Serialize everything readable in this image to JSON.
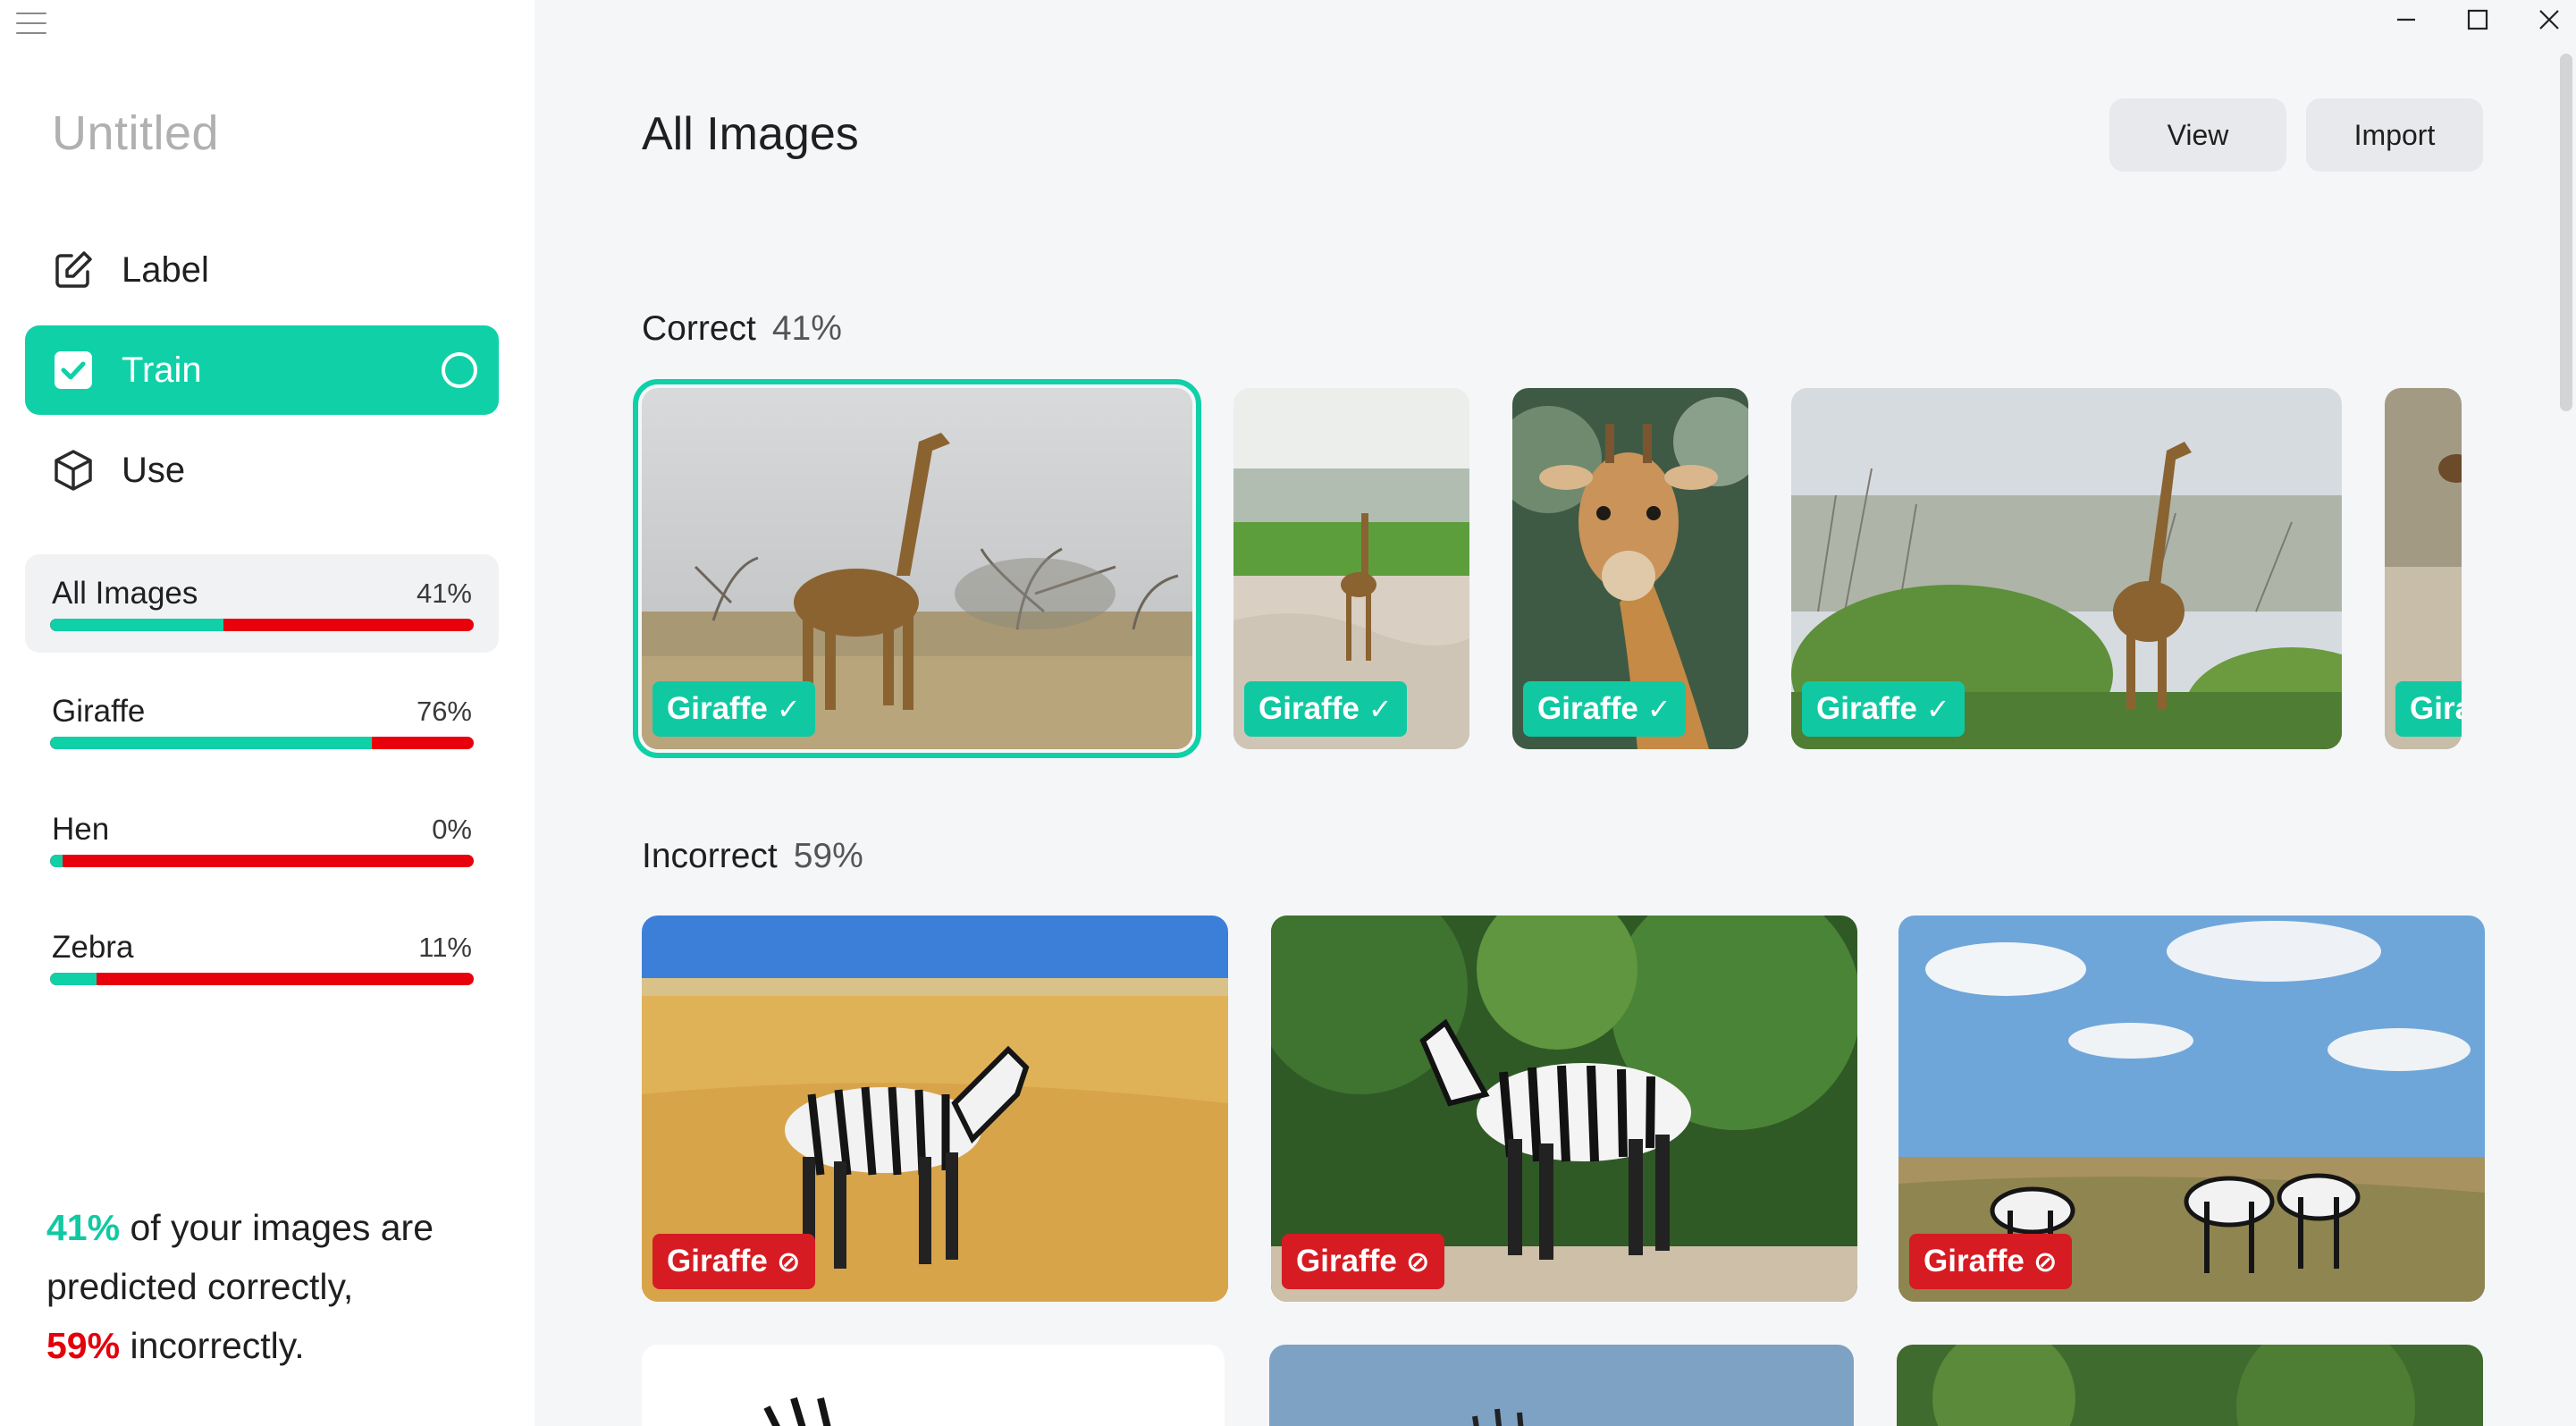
{
  "app": {
    "project_title": "Untitled"
  },
  "nav": {
    "label": "Label",
    "train": "Train",
    "use": "Use"
  },
  "classes": [
    {
      "name": "All Images",
      "pct": "41%",
      "accuracy": 0.41
    },
    {
      "name": "Giraffe",
      "pct": "76%",
      "accuracy": 0.76
    },
    {
      "name": "Hen",
      "pct": "0%",
      "accuracy": 0.0
    },
    {
      "name": "Zebra",
      "pct": "11%",
      "accuracy": 0.11
    }
  ],
  "summary": {
    "correct_pct": "41%",
    "text1": " of your images are predicted correctly,",
    "incorrect_pct": "59%",
    "text2": " incorrectly."
  },
  "main": {
    "title": "All Images",
    "view_label": "View",
    "import_label": "Import"
  },
  "sections": {
    "correct": {
      "title": "Correct",
      "pct": "41%"
    },
    "incorrect": {
      "title": "Incorrect",
      "pct": "59%"
    }
  },
  "correct_images": [
    {
      "label": "Giraffe",
      "icon": "check-icon"
    },
    {
      "label": "Giraffe",
      "icon": "check-icon"
    },
    {
      "label": "Giraffe",
      "icon": "check-icon"
    },
    {
      "label": "Giraffe",
      "icon": "check-icon"
    },
    {
      "label": "Gira",
      "icon": ""
    }
  ],
  "incorrect_images": [
    {
      "label": "Giraffe",
      "icon": "prohibited-icon"
    },
    {
      "label": "Giraffe",
      "icon": "prohibited-icon"
    },
    {
      "label": "Giraffe",
      "icon": "prohibited-icon"
    }
  ],
  "colors": {
    "accent": "#10d0a8",
    "error": "#e3000b",
    "tag_ok": "#10c9a2",
    "tag_err": "#d61b22"
  }
}
